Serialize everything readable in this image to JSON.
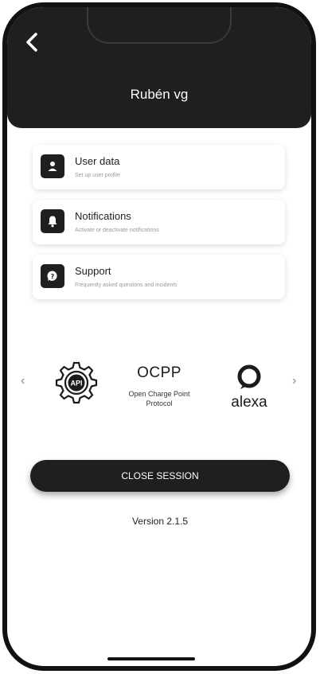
{
  "header": {
    "title": "Rubén vg",
    "back_icon": "chevron-left-icon"
  },
  "menu": {
    "items": [
      {
        "title": "User data",
        "subtitle": "Set up user profile",
        "icon": "user-icon"
      },
      {
        "title": "Notifications",
        "subtitle": "Activate or deactivate notifications",
        "icon": "bell-icon"
      },
      {
        "title": "Support",
        "subtitle": "Frequently asked questions and incidents",
        "icon": "help-bubble-icon"
      }
    ]
  },
  "integrations": {
    "api_label": "API",
    "ocpp_title": "OCPP",
    "ocpp_line1": "Open Charge Point",
    "ocpp_line2": "Protocol",
    "alexa_label": "alexa",
    "prev_arrow": "‹",
    "next_arrow": "›"
  },
  "actions": {
    "close_session": "CLOSE SESSION"
  },
  "footer": {
    "version": "Version 2.1.5"
  },
  "colors": {
    "dark": "#1f1f1f",
    "background": "#ffffff",
    "subtext": "#9a9a9a"
  }
}
